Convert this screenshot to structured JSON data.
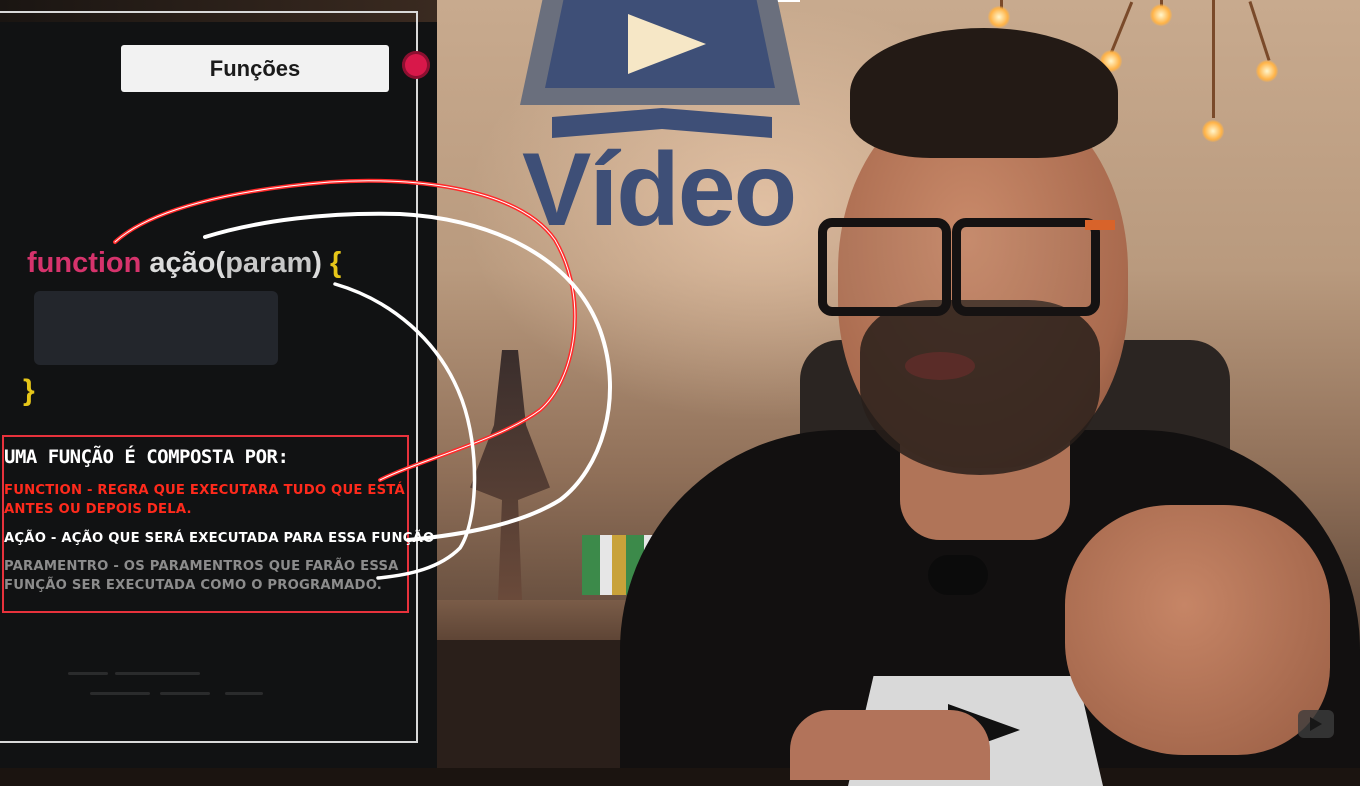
{
  "slide": {
    "title": "Funções",
    "code": {
      "keyword": "function",
      "name": "ação",
      "open_paren": "(",
      "param": "param",
      "close_paren": ")",
      "open_brace": "{",
      "close_brace": "}"
    },
    "notes": {
      "heading": "UMA FUNÇÃO É COMPOSTA POR:",
      "function_line1": "FUNCTION - REGRA QUE EXECUTARA TUDO QUE ESTÁ",
      "function_line2": "ANTES OU DEPOIS DELA.",
      "acao_line": "AÇÃO - AÇÃO QUE SERÁ EXECUTADA PARA ESSA FUNÇÃO",
      "param_line1": "PARAMENTRO - OS PARAMENTROS QUE FARÃO ESSA",
      "param_line2": "FUNÇÃO SER EXECUTADA COMO O PROGRAMADO."
    }
  },
  "background": {
    "logo_text": "Vídeo"
  },
  "colors": {
    "keyword": "#d6336c",
    "brace": "#e6c619",
    "note_red": "#ff2a1c",
    "note_gray": "#8c8c8c",
    "box_border": "#e8323c",
    "record_dot": "#d8184a"
  },
  "icons": {
    "record": "record-dot-icon",
    "watermark": "play-watermark-icon"
  }
}
